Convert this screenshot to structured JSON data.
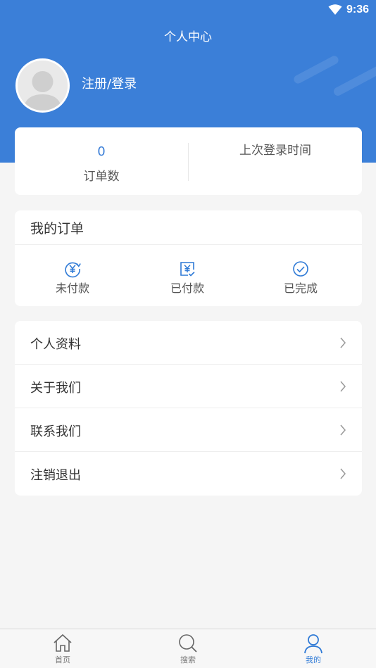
{
  "status_bar": {
    "time": "9:36"
  },
  "header": {
    "title": "个人中心",
    "login_text": "注册/登录"
  },
  "stats": {
    "order_count": "0",
    "order_count_label": "订单数",
    "last_login_label": "上次登录时间"
  },
  "orders": {
    "title": "我的订单",
    "items": [
      {
        "label": "未付款",
        "icon": "yen-refresh-icon"
      },
      {
        "label": "已付款",
        "icon": "yen-receipt-icon"
      },
      {
        "label": "已完成",
        "icon": "check-circle-icon"
      }
    ]
  },
  "menu": {
    "items": [
      {
        "label": "个人资料"
      },
      {
        "label": "关于我们"
      },
      {
        "label": "联系我们"
      },
      {
        "label": "注销退出"
      }
    ]
  },
  "tabbar": {
    "items": [
      {
        "label": "首页",
        "icon": "home-icon",
        "active": false
      },
      {
        "label": "搜索",
        "icon": "search-icon",
        "active": false
      },
      {
        "label": "我的",
        "icon": "user-icon",
        "active": true
      }
    ]
  },
  "colors": {
    "primary": "#3b7fd8",
    "background": "#f5f5f5",
    "icon_blue": "#2f7ad6"
  }
}
